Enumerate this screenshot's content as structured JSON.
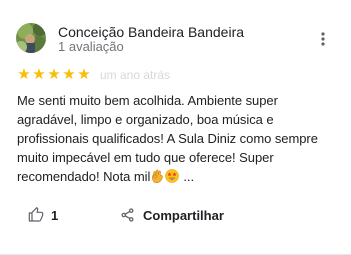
{
  "review": {
    "author_name": "Conceição Bandeira Bandeira",
    "author_meta": "1 avaliação",
    "rating": 5,
    "rating_max": 5,
    "time_label": "um ano atrás",
    "text": "Me senti muito bem acolhida. Ambiente super agradável, limpo e organizado, boa música e profissionais qualificados! A Sula Diniz como sempre muito impecável em tudo que oferece! Super recomendado! Nota mil",
    "emojis": [
      "ok-hand-emoji",
      "star-struck-emoji"
    ],
    "ellipsis": "...",
    "like_count": "1",
    "share_label": "Compartilhar"
  },
  "colors": {
    "star": "#fbbc04",
    "meta_text": "#70757a",
    "main_text": "#202124"
  },
  "icons": {
    "more": "more-vert-icon",
    "like": "thumb-up-icon",
    "share": "share-icon"
  }
}
